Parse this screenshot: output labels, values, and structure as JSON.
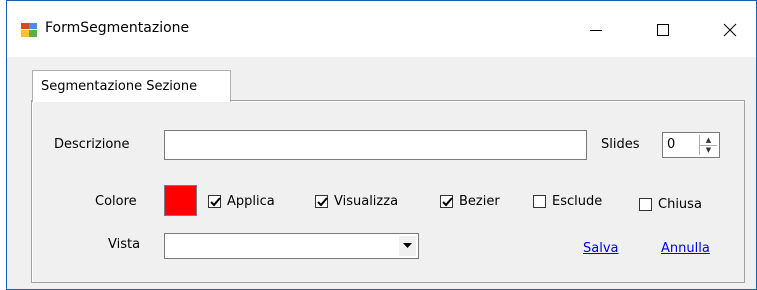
{
  "window": {
    "title": "FormSegmentazione",
    "controls": {
      "minimize": "minimize-icon",
      "maximize": "maximize-icon",
      "close": "close-icon"
    }
  },
  "tabs": [
    {
      "label": "Segmentazione Sezione",
      "active": true
    }
  ],
  "form": {
    "descrizione_label": "Descrizione",
    "descrizione_value": "",
    "slides_label": "Slides",
    "slides_value": "0",
    "colore_label": "Colore",
    "colore_value": "#ff0000",
    "checkboxes": [
      {
        "label": "Applica",
        "checked": true
      },
      {
        "label": "Visualizza",
        "checked": true
      },
      {
        "label": "Bezier",
        "checked": true
      },
      {
        "label": "Esclude",
        "checked": false
      },
      {
        "label": "Chiusa",
        "checked": false
      }
    ],
    "vista_label": "Vista",
    "vista_value": ""
  },
  "actions": {
    "salva": "Salva",
    "annulla": "Annulla"
  }
}
